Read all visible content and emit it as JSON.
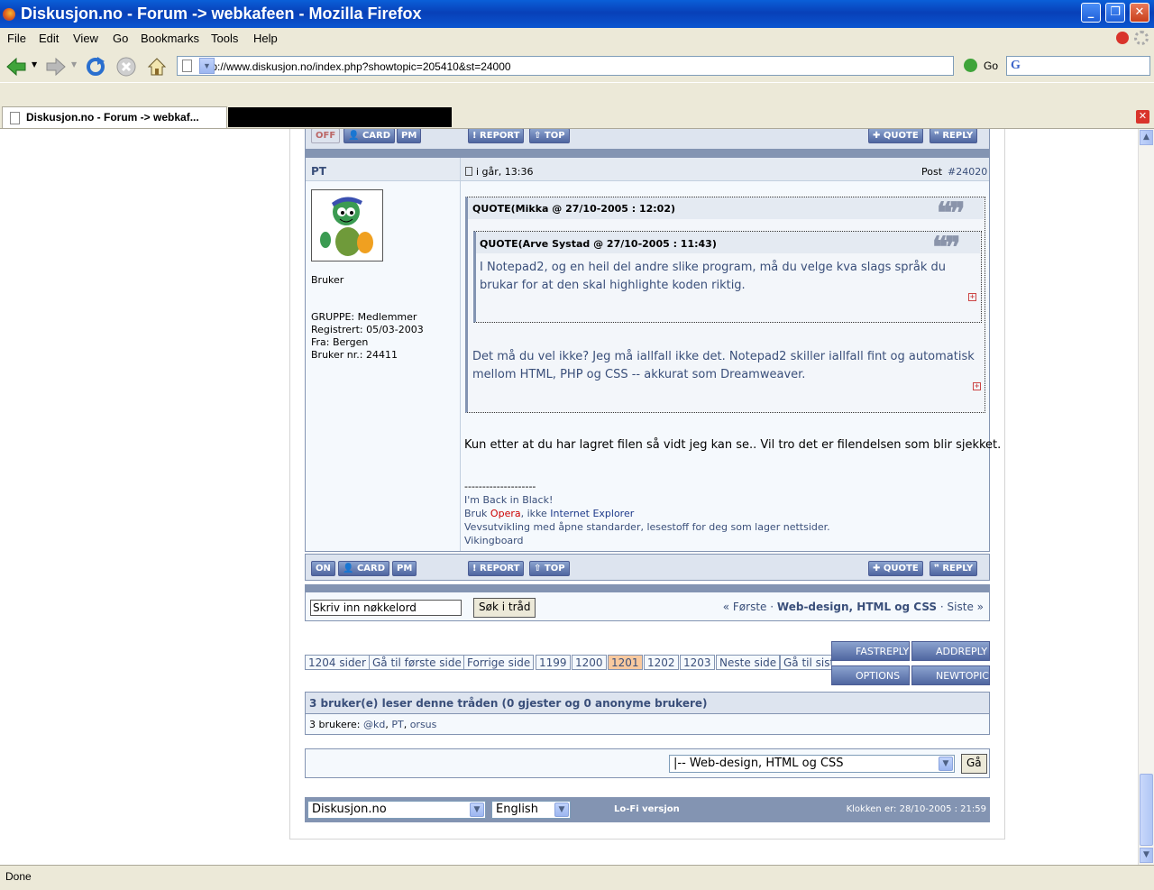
{
  "window": {
    "title": "Diskusjon.no - Forum -> webkafeen - Mozilla Firefox"
  },
  "menu": [
    "File",
    "Edit",
    "View",
    "Go",
    "Bookmarks",
    "Tools",
    "Help"
  ],
  "nav": {
    "url": "http://www.diskusjon.no/index.php?showtopic=205410&st=24000",
    "go_label": "Go"
  },
  "tabs": {
    "active": "Diskusjon.no - Forum -> webkaf..."
  },
  "prev_post_buttons": {
    "status": "OFF",
    "card": "CARD",
    "pm": "PM",
    "report": "REPORT",
    "top": "TOP",
    "quote": "QUOTE",
    "reply": "REPLY"
  },
  "post": {
    "author": "PT",
    "date": "i går, 13:36",
    "post_label": "Post",
    "post_number": "#24020",
    "user_title": "Bruker",
    "group": "GRUPPE: Medlemmer",
    "registered": "Registrert: 05/03-2003",
    "from": "Fra: Bergen",
    "user_no": "Bruker nr.: 24411",
    "quote_outer_header": "QUOTE(Mikka @ 27/10-2005 : 12:02)",
    "quote_inner_header": "QUOTE(Arve Systad @ 27/10-2005 : 11:43)",
    "quote_inner_text": "I Notepad2, og en heil del andre slike program, må du velge kva slags språk du brukar for at den skal highlighte koden riktig.",
    "quote_outer_text": "Det må du vel ikke? Jeg må iallfall ikke det. Notepad2 skiller iallfall fint og automatisk mellom HTML, PHP og CSS -- akkurat som Dreamweaver.",
    "body": "Kun etter at du har lagret filen så vidt jeg kan se.. Vil tro det er filendelsen som blir sjekket.",
    "sig_divider": "--------------------",
    "sig_line1": "I'm Back in Black!",
    "sig_bruk": "Bruk",
    "sig_opera": "Opera",
    "sig_ikke": ", ikke",
    "sig_ie": "Internet Explorer",
    "sig_line3": "Vevsutvikling med åpne standarder, lesestoff for deg som lager nettsider.",
    "sig_line4": "Vikingboard",
    "status": "ON",
    "card": "CARD",
    "pm": "PM",
    "report": "REPORT",
    "top": "TOP",
    "quote": "QUOTE",
    "reply": "REPLY"
  },
  "search": {
    "placeholder": "Skriv inn nøkkelord",
    "button": "Søk i tråd"
  },
  "topic_nav": {
    "first": "« Første",
    "sep1": "·",
    "forum": "Web-design, HTML og CSS",
    "sep2": "·",
    "last": "Siste »"
  },
  "pagination": [
    "1204 sider",
    "Gå til første side",
    "Forrige side",
    "1199",
    "1200",
    "1201",
    "1202",
    "1203",
    "Neste side",
    "Gå til sist"
  ],
  "actions": {
    "fastreply": "FASTREPLY",
    "addreply": "ADDREPLY",
    "options": "OPTIONS",
    "newtopic": "NEWTOPIC"
  },
  "readers": {
    "header": "3 bruker(e) leser denne tråden (0 gjester og 0 anonyme brukere)",
    "label": "3 brukere:",
    "users": [
      "@kd",
      "PT",
      "orsus"
    ]
  },
  "forum_jump": {
    "selected": "|-- Web-design, HTML og CSS",
    "button": "Gå"
  },
  "footer": {
    "skin": "Diskusjon.no",
    "language": "English",
    "lofi": "Lo-Fi versjon",
    "clock": "Klokken er: 28/10-2005 : 21:59"
  },
  "statusbar": "Done",
  "colors": {
    "titlebar": "#0a5fd8",
    "chrome": "#ece9d8",
    "accent": "#3a4f7a",
    "current_page": "#f9c99e",
    "opera_red": "#cc0000"
  }
}
